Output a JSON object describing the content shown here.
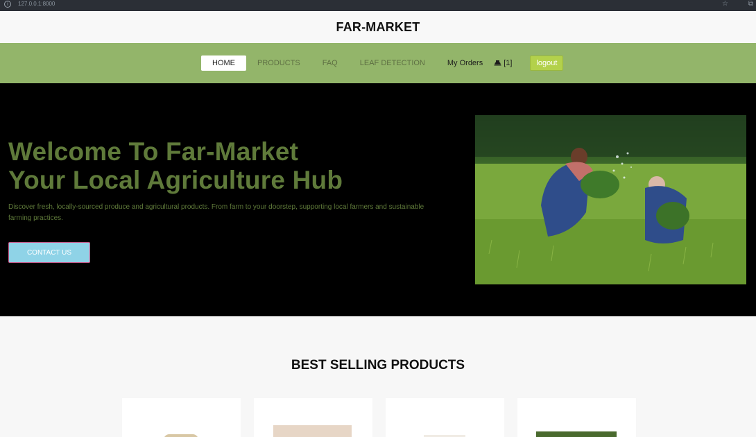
{
  "browser": {
    "url": "127.0.0.1:8000",
    "star_icon": "star-icon",
    "extension_icon": "puzzle-icon"
  },
  "brand": {
    "title": "FAR-MARKET"
  },
  "nav": {
    "items": [
      {
        "label": "HOME",
        "active": true
      },
      {
        "label": "PRODUCTS",
        "active": false
      },
      {
        "label": "FAQ",
        "active": false
      },
      {
        "label": "LEAF DETECTION",
        "active": false
      }
    ],
    "orders_label": "My Orders",
    "cart_count": "[1]",
    "logout_label": "logout"
  },
  "hero": {
    "title_line1": "Welcome To Far-Market",
    "title_line2": "Your Local Agriculture Hub",
    "description": "Discover fresh, locally-sourced produce and agricultural products. From farm to your doorstep, supporting local farmers and sustainable farming practices.",
    "contact_label": "CONTACT US"
  },
  "products_section": {
    "title": "BEST SELLING PRODUCTS"
  },
  "colors": {
    "nav_bg": "#93b56a",
    "hero_bg": "#000000",
    "hero_text": "#5f7a3a",
    "contact_bg": "#8fd3e7",
    "logout_bg": "#b3d14b"
  }
}
